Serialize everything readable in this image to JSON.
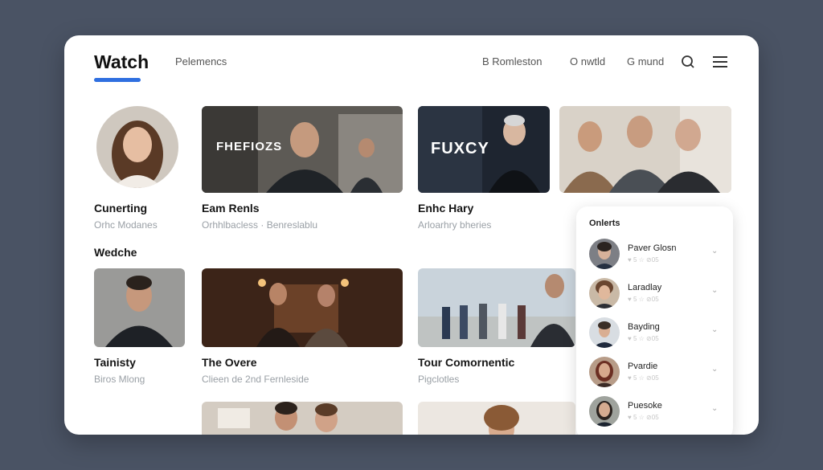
{
  "header": {
    "logo": "Watch",
    "nav_left": "Pelemencs",
    "nav_right": [
      "B Romleston",
      "O nwtld",
      "G mund"
    ]
  },
  "icons": {
    "search": "search-icon",
    "menu": "menu-icon"
  },
  "row1": [
    {
      "title": "Cunerting",
      "subtitle": "Orhc Modanes"
    },
    {
      "title": "Eam Renls",
      "subtitle": "Orhhlbacless · Benreslablu",
      "overlay": "FHEFIOZS"
    },
    {
      "title": "Enhc Hary",
      "subtitle": "Arloarhry bheries",
      "overlay": "FUXCY"
    }
  ],
  "section_label": "Wedche",
  "row2": [
    {
      "title": "Tainisty",
      "subtitle": "Biros Mlong"
    },
    {
      "title": "The Overe",
      "subtitle": "Clieen de 2nd Fernleside"
    },
    {
      "title": "Tour Comornentic",
      "subtitle": "Pigclotles"
    }
  ],
  "panel": {
    "title": "Onlerts",
    "items": [
      {
        "name": "Paver Glosn",
        "meta": "♥ 5  ☆  ⊘05"
      },
      {
        "name": "Laradlay",
        "meta": "♥ 5  ☆  ⊘05"
      },
      {
        "name": "Bayding",
        "meta": "♥ 5  ☆  ⊘05"
      },
      {
        "name": "Pvardie",
        "meta": "♥ 5  ☆  ⊘05"
      },
      {
        "name": "Puesoke",
        "meta": "♥ 5  ☆  ⊘05"
      }
    ]
  },
  "colors": {
    "accent": "#2f6fe0",
    "background": "#4a5364"
  }
}
